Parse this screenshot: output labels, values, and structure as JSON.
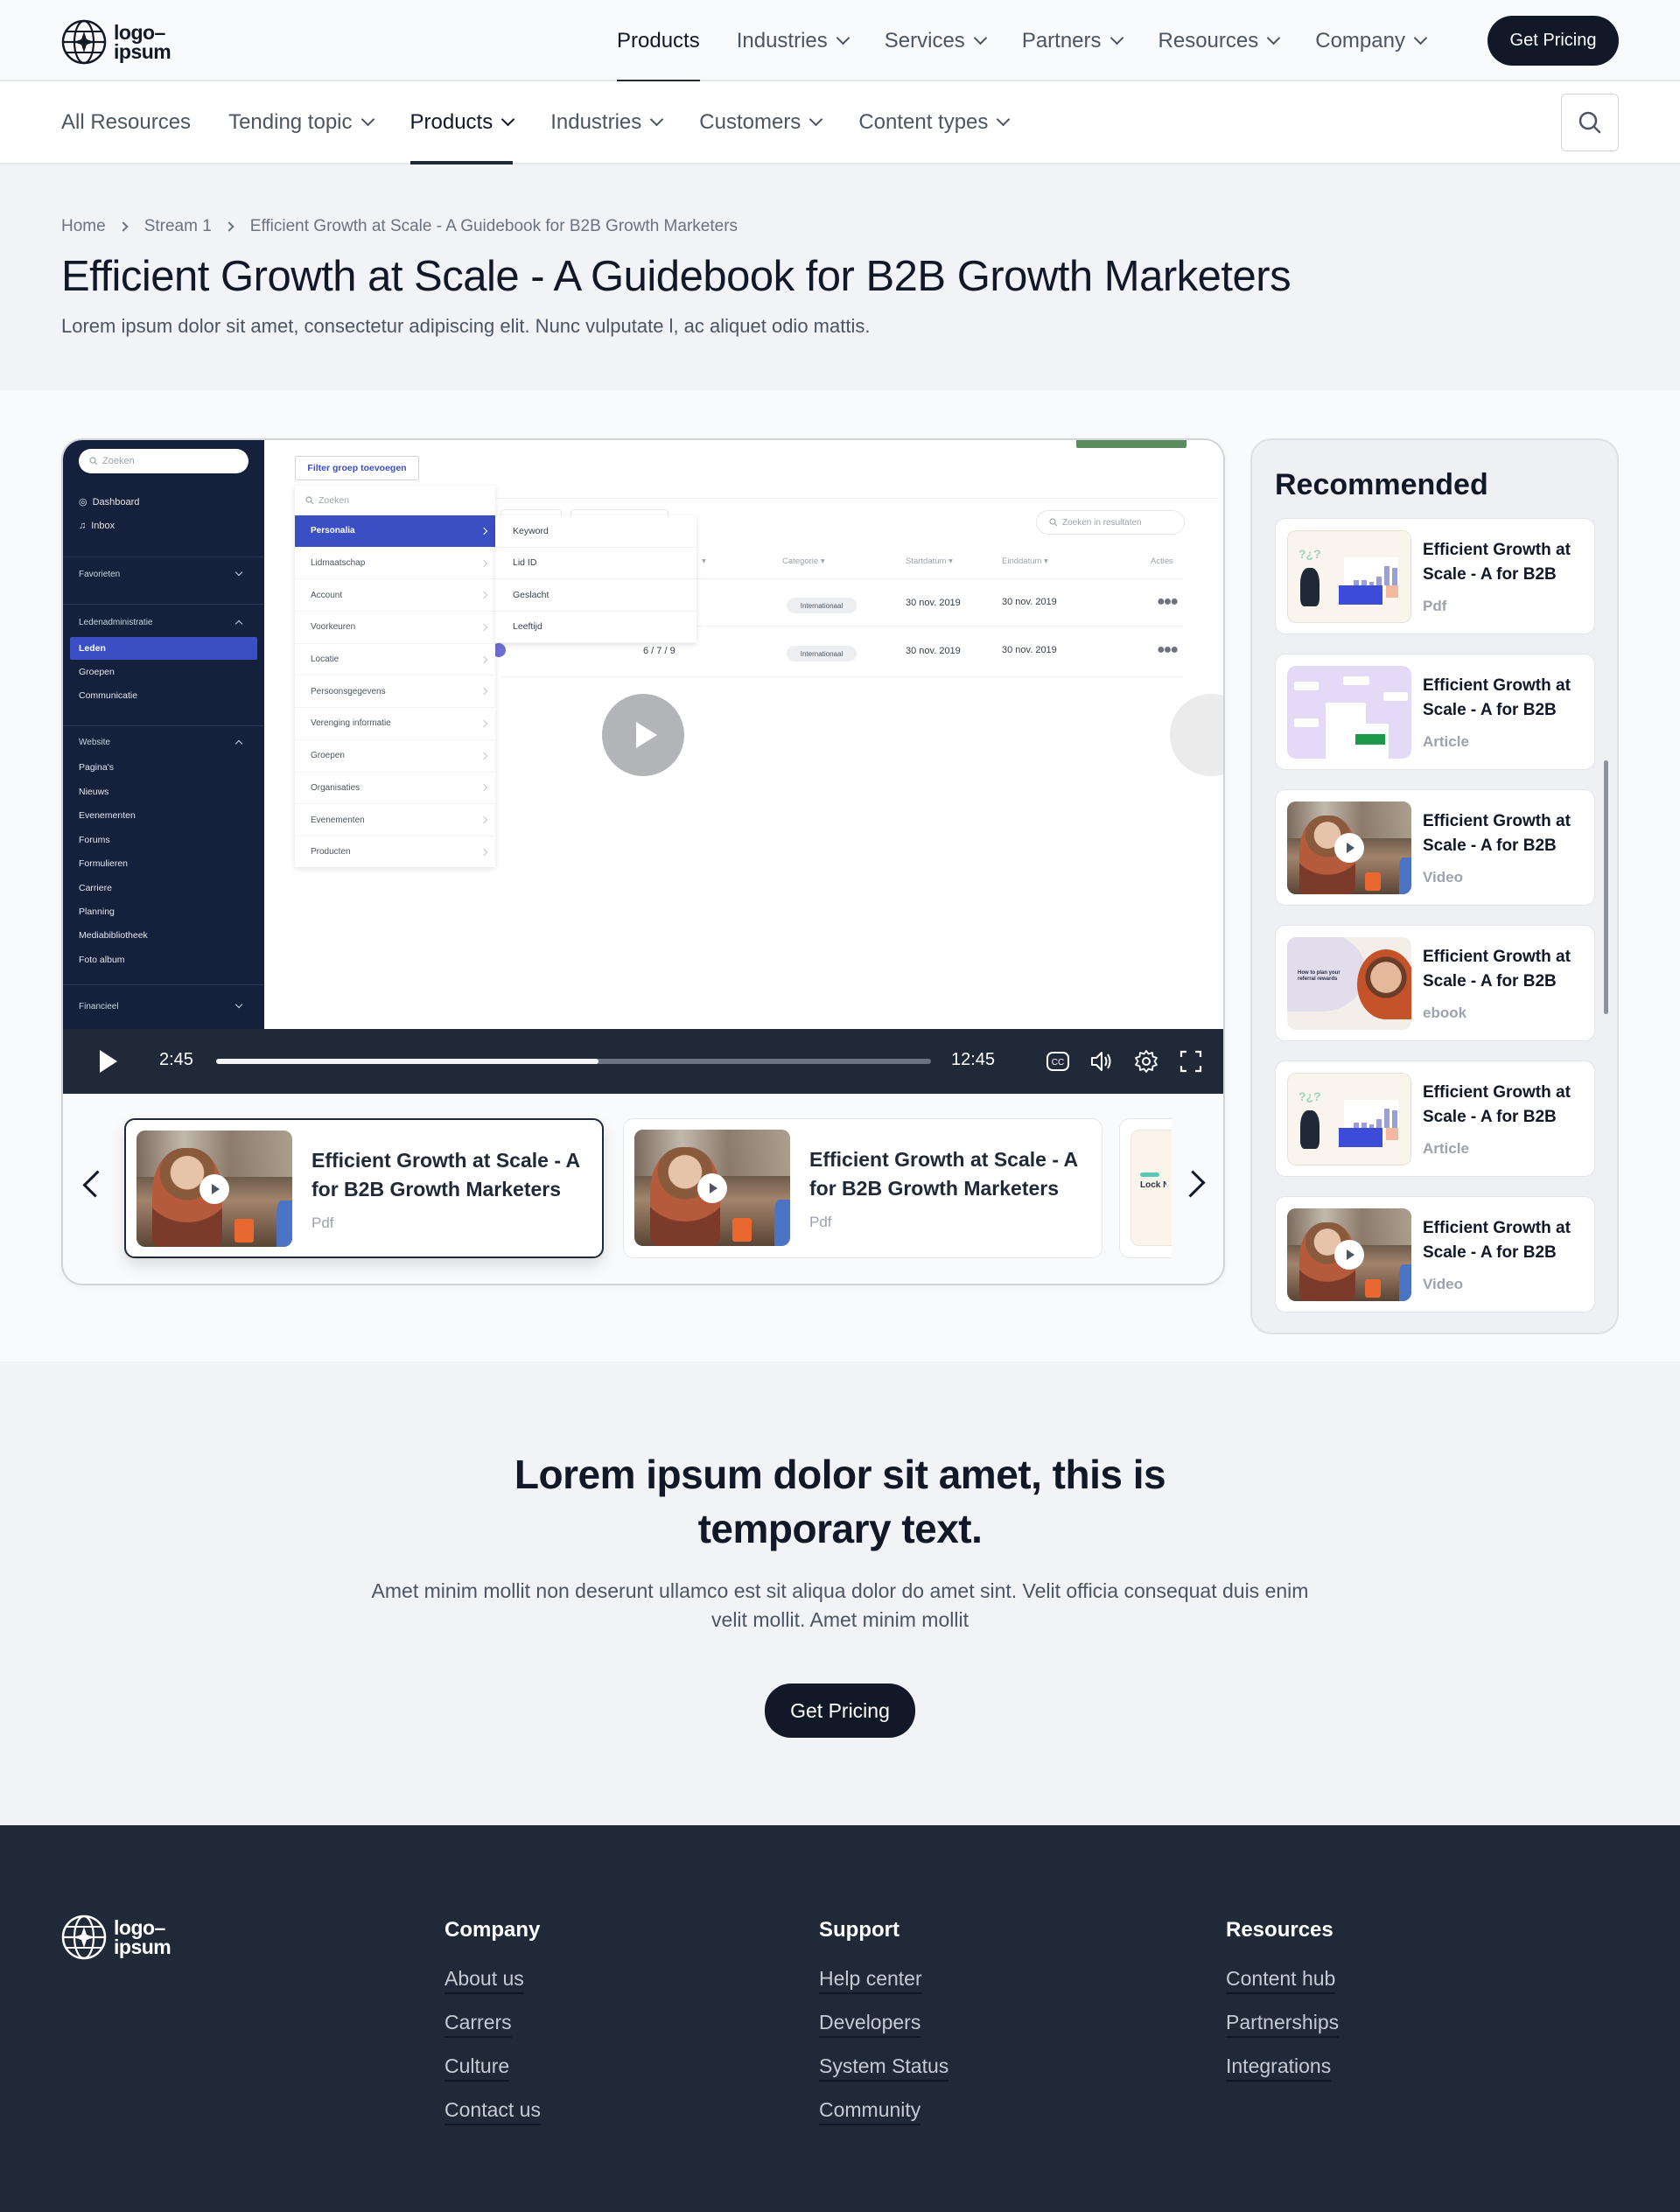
{
  "brand": {
    "logo_line1": "logo–",
    "logo_line2": "ipsum"
  },
  "topnav": {
    "items": [
      {
        "label": "Products",
        "active": true
      },
      {
        "label": "Industries",
        "dropdown": true
      },
      {
        "label": "Services",
        "dropdown": true
      },
      {
        "label": "Partners",
        "dropdown": true
      },
      {
        "label": "Resources",
        "dropdown": true
      },
      {
        "label": "Company",
        "dropdown": true
      }
    ],
    "cta_label": "Get Pricing"
  },
  "subnav": {
    "items": [
      {
        "label": "All Resources"
      },
      {
        "label": "Tending topic",
        "dropdown": true
      },
      {
        "label": "Products",
        "dropdown": true,
        "active": true
      },
      {
        "label": "Industries",
        "dropdown": true
      },
      {
        "label": "Customers",
        "dropdown": true
      },
      {
        "label": "Content types",
        "dropdown": true
      }
    ],
    "search_icon": "search-icon"
  },
  "hero": {
    "breadcrumb": [
      "Home",
      "Stream 1",
      "Efficient Growth at Scale - A Guidebook for B2B Growth Marketers"
    ],
    "title": "Efficient Growth at Scale - A Guidebook for B2B Growth Marketers",
    "subtitle": "Lorem ipsum dolor sit amet, consectetur adipiscing elit. Nunc vulputate l, ac aliquet odio mattis."
  },
  "video": {
    "app_sidebar": {
      "search_placeholder": "Zoeken",
      "dashboard": "Dashboard",
      "inbox": "Inbox",
      "favorieten": "Favorieten",
      "ledenadministratie": "Ledenadministratie",
      "leden_links": [
        "Leden",
        "Groepen",
        "Communicatie"
      ],
      "website": "Website",
      "website_links": [
        "Pagina's",
        "Nieuws",
        "Evenementen",
        "Forums",
        "Formulieren",
        "Carriere",
        "Planning",
        "Mediabibliotheek",
        "Foto album"
      ],
      "financieel": "Financieel"
    },
    "app_content": {
      "filter_button": "Filter groep toevoegen",
      "menu_search_placeholder": "Zoeken",
      "menu_items": [
        "Personalia",
        "Lidmaatschap",
        "Account",
        "Voorkeuren",
        "Locatie",
        "Persoonsgegevens",
        "Verenging informatie",
        "Groepen",
        "Organisaties",
        "Evenementen",
        "Producten"
      ],
      "submenu_items": [
        "Keyword",
        "Lid ID",
        "Geslacht",
        "Leeftijd"
      ],
      "results_search_placeholder": "Zoeken in resultaten",
      "columns": [
        "Categorie",
        "Startdatum",
        "Einddatum",
        "Acties"
      ],
      "rows": [
        {
          "id": "",
          "category": "Internationaal",
          "start": "30 nov. 2019",
          "end": "30 nov. 2019"
        },
        {
          "id": "6 / 7 / 9",
          "category": "Internationaal",
          "start": "30 nov. 2019",
          "end": "30 nov. 2019"
        }
      ]
    },
    "controls": {
      "current_time": "2:45",
      "duration": "12:45",
      "progress_fraction": 0.535,
      "icons": [
        "captions-icon",
        "volume-icon",
        "settings-icon",
        "fullscreen-icon"
      ]
    }
  },
  "playlist": [
    {
      "title": "Efficient Growth at Scale - A for B2B Growth Marketers",
      "type": "Pdf",
      "active": true
    },
    {
      "title": "Efficient Growth at Scale - A for B2B Growth Marketers",
      "type": "Pdf"
    },
    {
      "title": "Lock New Cont",
      "type": ""
    }
  ],
  "recommended": {
    "title": "Recommended",
    "items": [
      {
        "title": "Efficient Growth at Scale - A for B2B",
        "type": "Pdf",
        "thumb": "illustration"
      },
      {
        "title": "Efficient Growth at Scale - A for B2B",
        "type": "Article",
        "thumb": "diagram"
      },
      {
        "title": "Efficient Growth at Scale - A for B2B",
        "type": "Video",
        "thumb": "video"
      },
      {
        "title": "Efficient Growth at Scale - A for B2B",
        "type": "ebook",
        "thumb": "ebook",
        "ebook_text": "How to plan your referral rewards"
      },
      {
        "title": "Efficient Growth at Scale - A for B2B",
        "type": "Article",
        "thumb": "illustration"
      },
      {
        "title": "Efficient Growth at Scale - A for B2B",
        "type": "Video",
        "thumb": "video"
      }
    ]
  },
  "cta": {
    "title": "Lorem ipsum dolor sit amet, this is temporary text.",
    "text": "Amet minim mollit non deserunt ullamco est sit aliqua dolor do amet sint. Velit officia consequat duis enim velit mollit. Amet minim mollit",
    "button": "Get Pricing"
  },
  "footer": {
    "columns": [
      {
        "heading": "Company",
        "links": [
          "About us",
          "Carrers",
          "Culture",
          "Contact us"
        ]
      },
      {
        "heading": "Support",
        "links": [
          "Help center",
          "Developers",
          "System Status",
          "Community"
        ]
      },
      {
        "heading": "Resources",
        "links": [
          "Content hub",
          "Partnerships",
          "Integrations"
        ]
      }
    ]
  },
  "colors": {
    "dark": "#111827",
    "footer_bg": "#1f2937",
    "app_sidebar": "#15203d",
    "app_accent": "#3b4fc4"
  }
}
